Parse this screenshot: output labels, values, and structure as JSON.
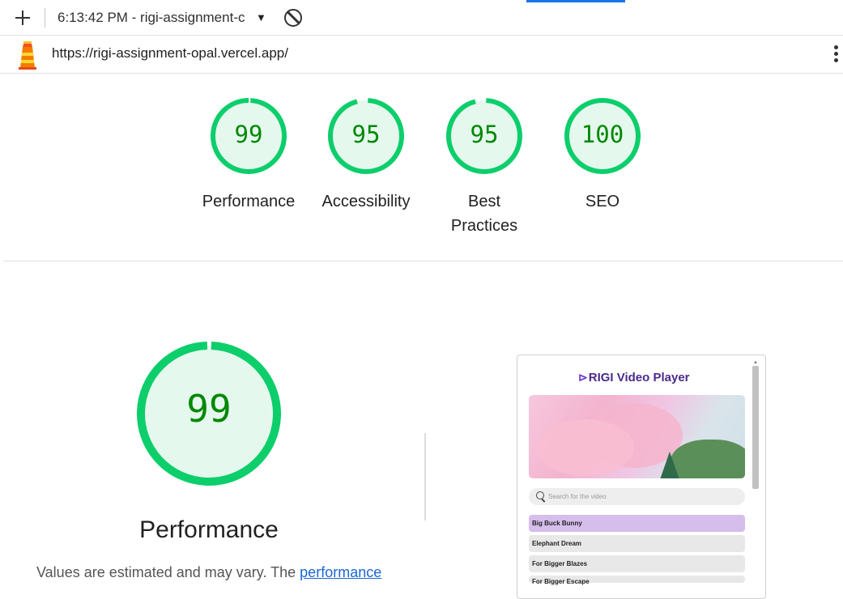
{
  "toolbar": {
    "session_label": "6:13:42 PM - rigi-assignment-c",
    "accent_color": "#1a73e8"
  },
  "url": {
    "text": "https://rigi-assignment-opal.vercel.app/"
  },
  "gauges": [
    {
      "score": "99",
      "label": "Performance",
      "value": 0.99
    },
    {
      "score": "95",
      "label": "Accessibility",
      "value": 0.95
    },
    {
      "score": "95",
      "label": "Best Practices",
      "value": 0.95
    },
    {
      "score": "100",
      "label": "SEO",
      "value": 1.0
    }
  ],
  "colors": {
    "pass": "#0cce6b",
    "pass_fill": "#e5f8ee",
    "score_text": "#008800"
  },
  "performance": {
    "score": "99",
    "value": 0.99,
    "title": "Performance",
    "note_prefix": "Values are estimated and may vary. The ",
    "note_link": "performance"
  },
  "thumbnail": {
    "title": "RIGI Video Player",
    "logo_glyph": "⊳",
    "search_placeholder": "Search for the video",
    "videos": [
      "Big Buck Bunny",
      "Elephant Dream",
      "For Bigger Blazes",
      "For Bigger Escape"
    ]
  }
}
